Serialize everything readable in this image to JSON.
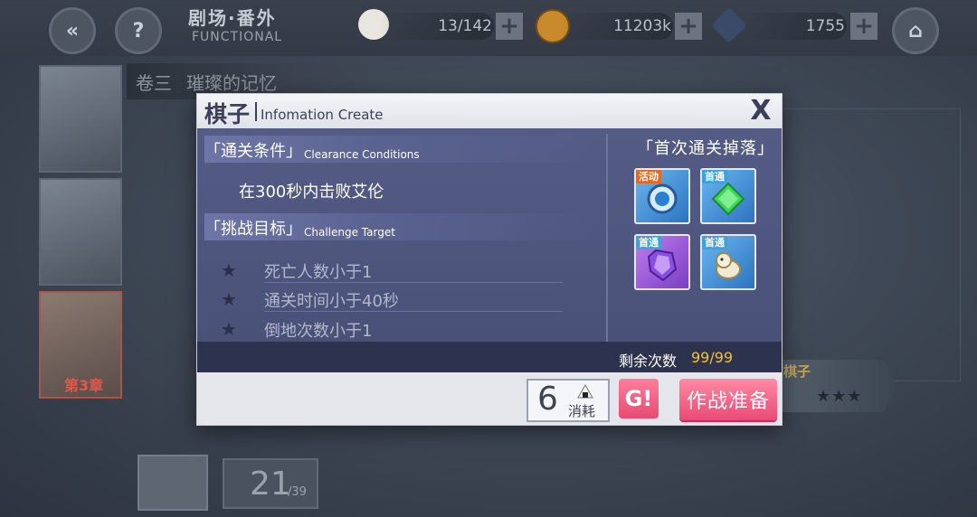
{
  "header": {
    "stage_title": "剧场·番外",
    "stage_subtitle": "FUNCTIONAL",
    "resources": [
      {
        "icon": "rice-ball-icon",
        "value": "13/142"
      },
      {
        "icon": "coin-icon",
        "value": "11203k"
      },
      {
        "icon": "crystal-cube-icon",
        "value": "1755"
      }
    ]
  },
  "background": {
    "chapter_label": "卷三",
    "chapter_name": "璀璨的记忆",
    "chapter_badge": "第3章",
    "progress_current": "21",
    "progress_total": "/39",
    "stage_card_name": "棋子"
  },
  "dialog": {
    "title": "棋子",
    "subtitle": "Infomation Create",
    "close_label": "X",
    "clearance": {
      "heading_cn": "「通关条件」",
      "heading_en": "Clearance Conditions",
      "text": "在300秒内击败艾伦"
    },
    "challenge": {
      "heading_cn": "「挑战目标」",
      "heading_en": "Challenge Target",
      "targets": [
        "死亡人数小于1",
        "通关时间小于40秒",
        "倒地次数小于1"
      ]
    },
    "drops": {
      "title": "「首次通关掉落」",
      "items": [
        {
          "tag": "活动",
          "icon": "blue-orb-item-icon",
          "rarity": "blue"
        },
        {
          "tag": "首通",
          "icon": "green-gem-item-icon",
          "rarity": "blue"
        },
        {
          "tag": "首通",
          "icon": "purple-crystal-item-icon",
          "rarity": "purple"
        },
        {
          "tag": "首通",
          "icon": "pet-figure-item-icon",
          "rarity": "blue"
        }
      ]
    },
    "remaining": {
      "label": "剩余次数",
      "value": "99/99"
    },
    "cost": {
      "value": "6",
      "label": "消耗"
    },
    "auto_button_label": "G!",
    "battle_button_label": "作战准备"
  }
}
